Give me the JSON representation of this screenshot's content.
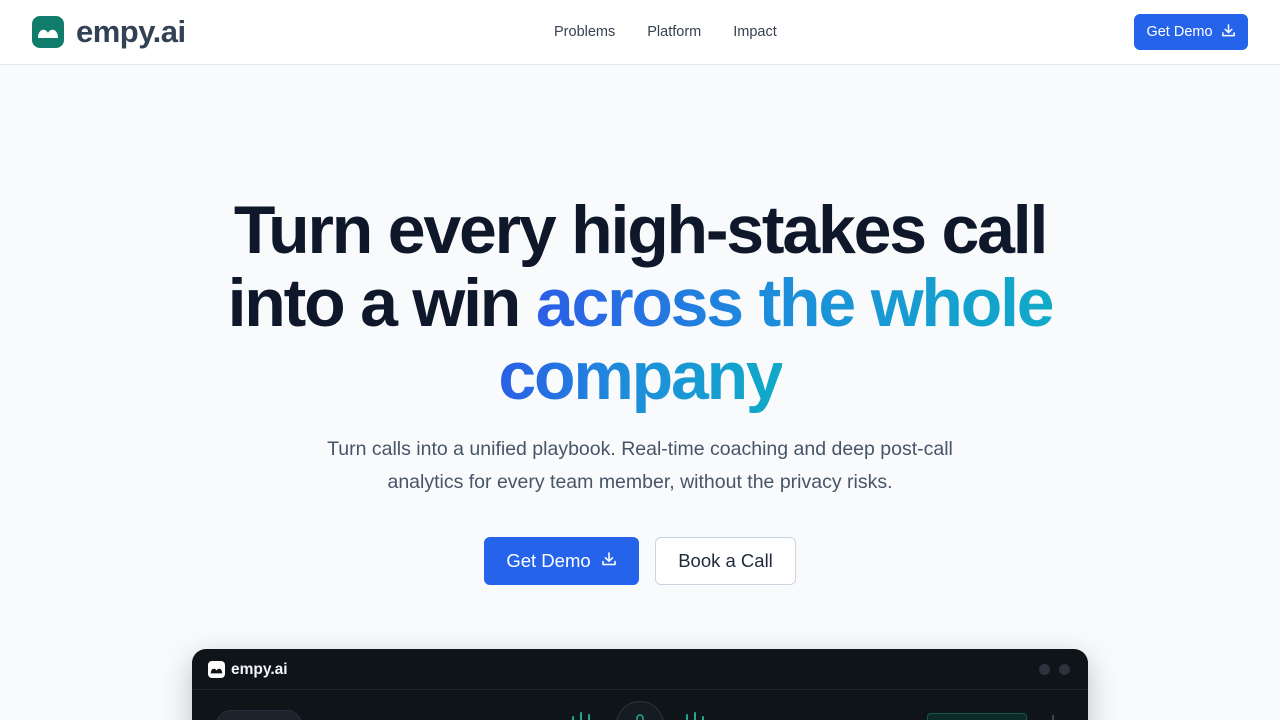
{
  "brand": {
    "name": "empy.ai",
    "icon": "empy-logo-icon",
    "color": "#0f7d6a"
  },
  "nav": {
    "items": [
      {
        "label": "Problems"
      },
      {
        "label": "Platform"
      },
      {
        "label": "Impact"
      }
    ],
    "cta_label": "Get Demo",
    "cta_icon": "download-icon"
  },
  "hero": {
    "title_line1": "Turn every high-stakes call",
    "title_line2_plain": "into a win ",
    "title_line2_accent": "across the whole",
    "title_line3_accent": "company",
    "subtitle_line1": "Turn calls into a unified playbook. Real-time coaching and deep post-call",
    "subtitle_line2": "analytics for every team member, without the privacy risks.",
    "primary_button": "Get Demo",
    "secondary_button": "Book a Call"
  },
  "preview": {
    "brand_name": "empy.ai"
  },
  "colors": {
    "accent": "#2563eb",
    "gradient_start": "#2b5ee6",
    "gradient_end": "#10aac8",
    "preview_bg": "#0f1419"
  }
}
